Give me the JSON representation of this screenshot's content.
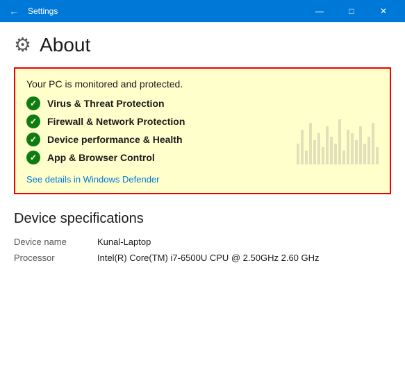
{
  "titlebar": {
    "title": "Settings",
    "back_icon": "←",
    "minimize": "—",
    "maximize": "□",
    "close": "✕"
  },
  "page": {
    "header_icon": "⚙",
    "title": "About"
  },
  "security": {
    "status_text": "Your PC is monitored and protected.",
    "items": [
      {
        "label": "Virus & Threat Protection"
      },
      {
        "label": "Firewall & Network Protection"
      },
      {
        "label": "Device performance & Health"
      },
      {
        "label": "App & Browser Control"
      }
    ],
    "link_text": "See details in Windows Defender"
  },
  "device_specs": {
    "section_title": "Device specifications",
    "rows": [
      {
        "label": "Device name",
        "value": "Kunal-Laptop"
      },
      {
        "label": "Processor",
        "value": "Intel(R) Core(TM) i7-6500U CPU @ 2.50GHz   2.60 GHz"
      }
    ]
  }
}
